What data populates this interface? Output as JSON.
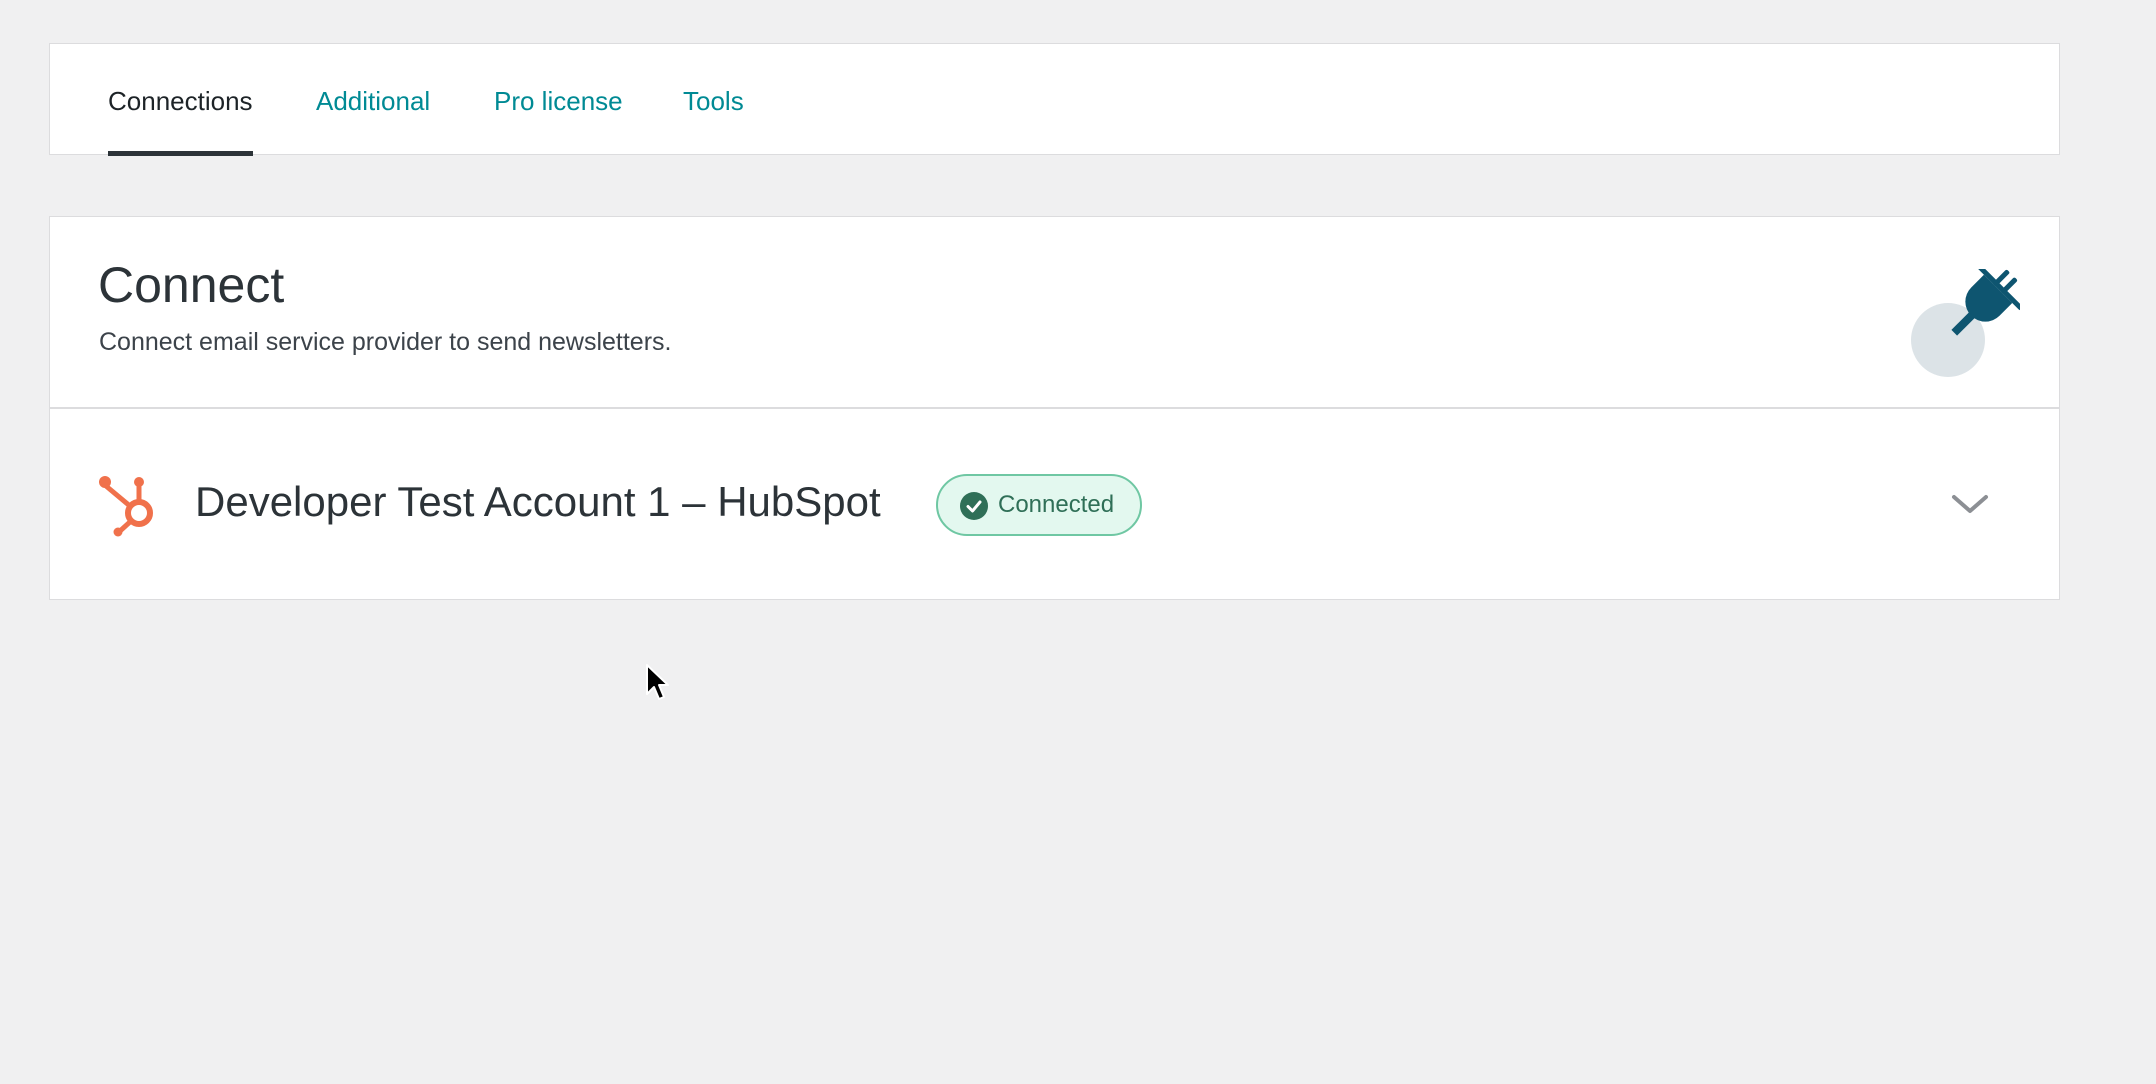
{
  "tabs": [
    {
      "label": "Connections",
      "active": true
    },
    {
      "label": "Additional",
      "active": false
    },
    {
      "label": "Pro license",
      "active": false
    },
    {
      "label": "Tools",
      "active": false
    }
  ],
  "connect": {
    "title": "Connect",
    "description": "Connect email service provider to send newsletters.",
    "icon": "plug-icon"
  },
  "account": {
    "name": "Developer Test Account 1 – HubSpot",
    "logo_icon": "hubspot-icon",
    "status_label": "Connected",
    "status_icon": "check-circle-icon",
    "expand_icon": "chevron-down-icon"
  },
  "colors": {
    "background": "#f0f0f1",
    "link": "#008a94",
    "hubspot_orange": "#f0714b",
    "plug": "#0e5570",
    "badge_bg": "#e3f8ef",
    "badge_border": "#6fc7a3",
    "badge_text": "#2f6f57"
  }
}
